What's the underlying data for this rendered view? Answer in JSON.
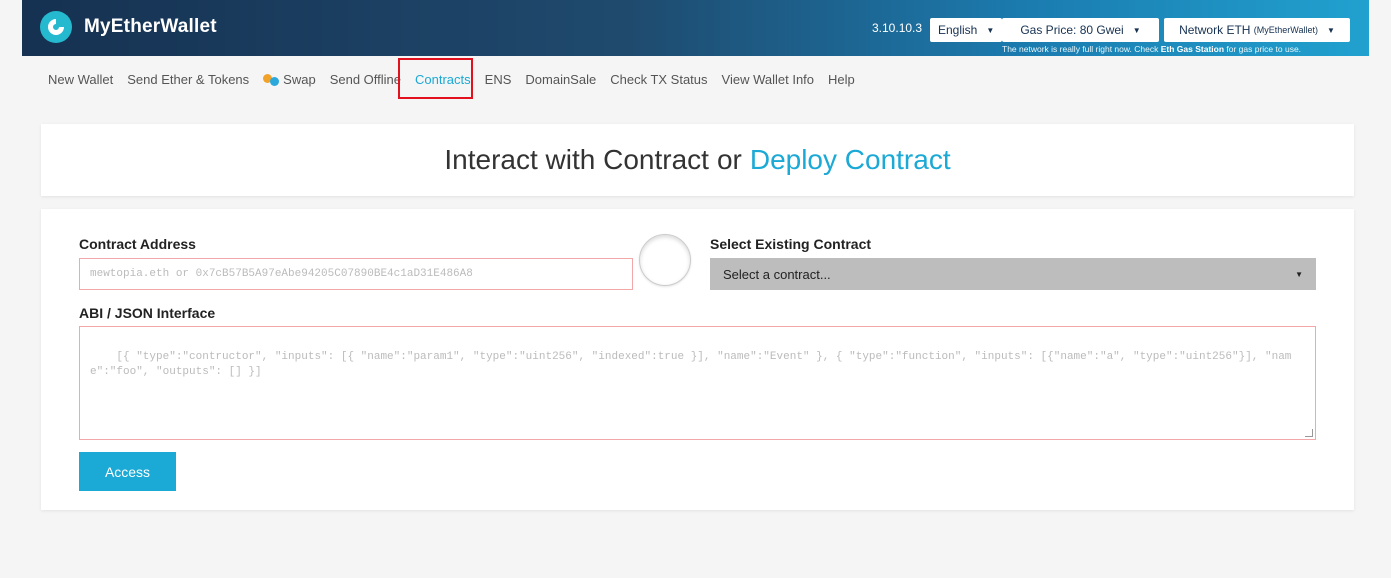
{
  "header": {
    "brand": "MyEtherWallet",
    "version": "3.10.10.3",
    "language_label": "English",
    "gas_price_label": "Gas Price: 80 Gwei",
    "network_label": "Network ETH",
    "network_sub": "(MyEtherWallet)",
    "gas_note_prefix": "The network is really full right now. Check ",
    "gas_note_link": "Eth Gas Station",
    "gas_note_suffix": " for gas price to use."
  },
  "nav": {
    "items": [
      {
        "label": "New Wallet"
      },
      {
        "label": "Send Ether & Tokens"
      },
      {
        "label": "Swap"
      },
      {
        "label": "Send Offline"
      },
      {
        "label": "Contracts"
      },
      {
        "label": "ENS"
      },
      {
        "label": "DomainSale"
      },
      {
        "label": "Check TX Status"
      },
      {
        "label": "View Wallet Info"
      },
      {
        "label": "Help"
      }
    ],
    "active": "Contracts"
  },
  "title": {
    "interact": "Interact with Contract",
    "or": "or",
    "deploy": "Deploy Contract"
  },
  "form": {
    "contract_address_label": "Contract Address",
    "contract_address_placeholder": "mewtopia.eth or 0x7cB57B5A97eAbe94205C07890BE4c1aD31E486A8",
    "select_existing_label": "Select Existing Contract",
    "select_placeholder": "Select a contract...",
    "abi_label": "ABI / JSON Interface",
    "abi_placeholder": "[{ \"type\":\"contructor\", \"inputs\": [{ \"name\":\"param1\", \"type\":\"uint256\", \"indexed\":true }], \"name\":\"Event\" }, { \"type\":\"function\", \"inputs\": [{\"name\":\"a\", \"type\":\"uint256\"}], \"name\":\"foo\", \"outputs\": [] }]",
    "access_label": "Access"
  },
  "colors": {
    "accent": "#1ba9d5",
    "highlight": "#e3101d"
  }
}
